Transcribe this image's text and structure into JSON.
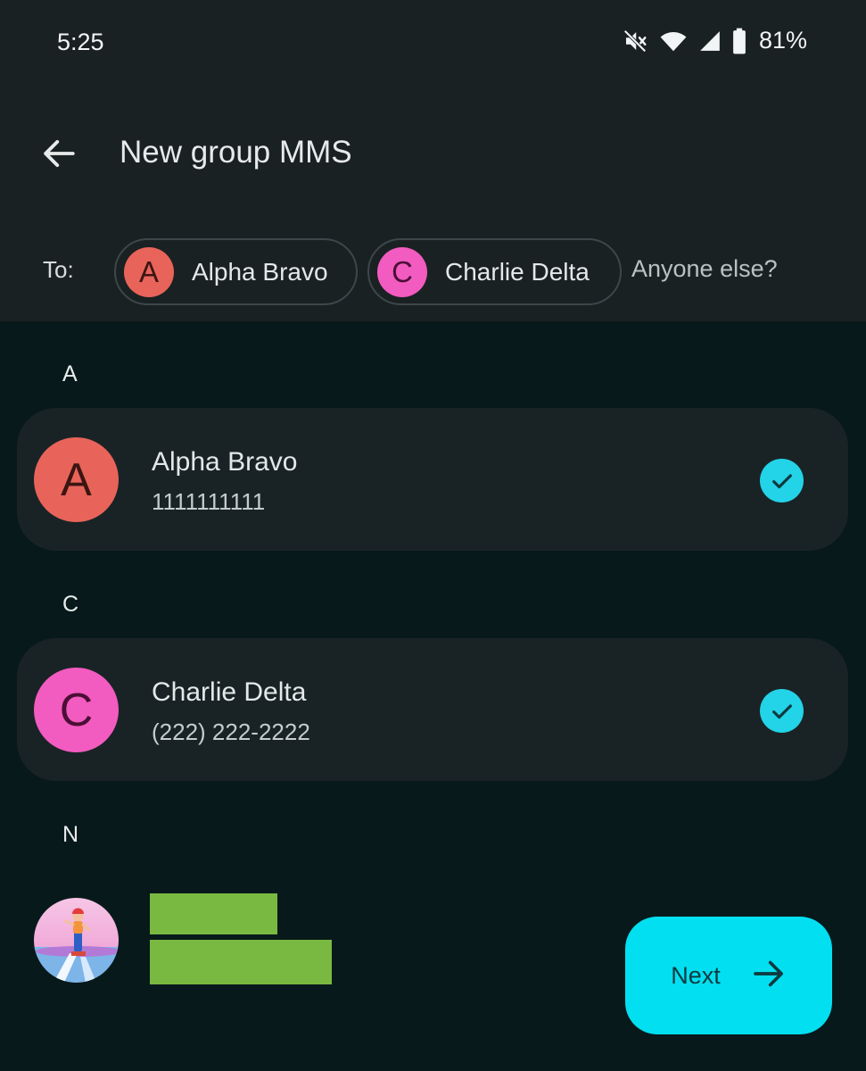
{
  "status_bar": {
    "time": "5:25",
    "battery": "81%",
    "icons": [
      "mute-icon",
      "wifi-icon",
      "signal-icon",
      "battery-icon"
    ]
  },
  "header": {
    "title": "New group MMS",
    "back_icon": "arrow-back-icon"
  },
  "recipients": {
    "to_label": "To:",
    "chips": [
      {
        "initial": "A",
        "name": "Alpha Bravo",
        "color": "#e8645a"
      },
      {
        "initial": "C",
        "name": "Charlie Delta",
        "color": "#f25bbf"
      }
    ],
    "input_placeholder": "Anyone else?"
  },
  "contacts": {
    "sections": [
      {
        "letter": "A",
        "name": "Alpha Bravo",
        "phone": "1111111111",
        "initial": "A",
        "avatar_color": "#e8645a",
        "selected": true
      },
      {
        "letter": "C",
        "name": "Charlie Delta",
        "phone": "(222) 222-2222",
        "initial": "C",
        "avatar_color": "#f25bbf",
        "selected": true
      },
      {
        "letter": "N"
      }
    ]
  },
  "fab": {
    "label": "Next",
    "icon": "arrow-forward-icon",
    "color": "#02dff0"
  },
  "colors": {
    "header_bg": "#1a2123",
    "page_bg": "#08191b",
    "card_bg": "#192325",
    "check": "#23d3e8",
    "redaction": "#79b941"
  }
}
